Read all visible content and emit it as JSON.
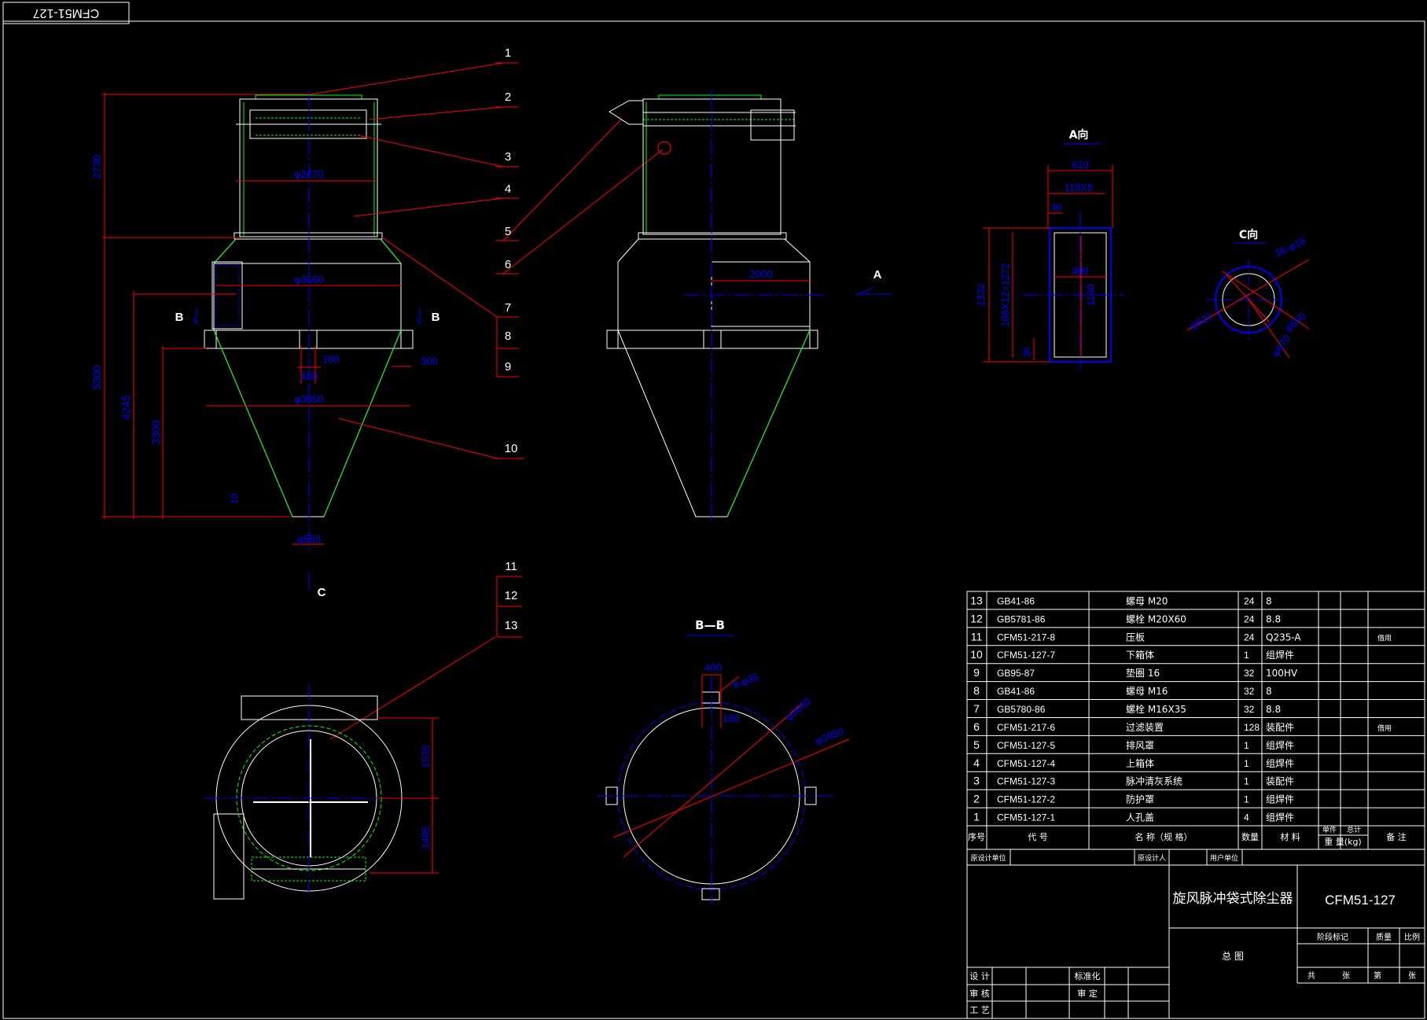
{
  "drawing_code_mirrored": "CFM51-127",
  "leaders": [
    "1",
    "2",
    "3",
    "4",
    "5",
    "6",
    "7",
    "8",
    "9",
    "10",
    "11",
    "12",
    "13"
  ],
  "front_view": {
    "dims": {
      "h2730": "2730",
      "h5300": "5300",
      "h4245": "4245",
      "h3300": "3300",
      "d2670": "φ2670",
      "d3660": "φ3660",
      "d3950": "φ3950",
      "d550": "φ550",
      "w180": "180",
      "w300": "300",
      "w480": "480",
      "s10": "10"
    },
    "section_b": "B",
    "view_c": "C"
  },
  "side_view": {
    "dim2000": "2000",
    "view_a": "A"
  },
  "view_a": {
    "title": "A向",
    "w610": "610",
    "w118": "118X5",
    "w30": "30",
    "w490": "490",
    "h1332": "1332",
    "h1272": "106X12=1272",
    "h1180": "1180",
    "h36": "36"
  },
  "view_c": {
    "title": "C向",
    "holes": "16-φ18",
    "d620": "φ620",
    "d650": "φ650",
    "d670": "φ670"
  },
  "section_bb": {
    "title": "B—B",
    "w400": "400",
    "holes": "8-φ35",
    "w180": "180",
    "d3660": "φ3660",
    "d3950": "φ3950"
  },
  "plan_view": {
    "h1535": "1535",
    "h1485": "1485"
  },
  "bom": {
    "rows": [
      {
        "no": "13",
        "code": "GB41-86",
        "name": "螺母 M20",
        "qty": "24",
        "mat": "8",
        "note": ""
      },
      {
        "no": "12",
        "code": "GB5781-86",
        "name": "螺栓 M20X60",
        "qty": "24",
        "mat": "8.8",
        "note": ""
      },
      {
        "no": "11",
        "code": "CFM51-217-8",
        "name": "压板",
        "qty": "24",
        "mat": "Q235-A",
        "note": "借用"
      },
      {
        "no": "10",
        "code": "CFM51-127-7",
        "name": "下箱体",
        "qty": "1",
        "mat": "组焊件",
        "note": ""
      },
      {
        "no": "9",
        "code": "GB95-87",
        "name": "垫圈 16",
        "qty": "32",
        "mat": "100HV",
        "note": ""
      },
      {
        "no": "8",
        "code": "GB41-86",
        "name": "螺母 M16",
        "qty": "32",
        "mat": "8",
        "note": ""
      },
      {
        "no": "7",
        "code": "GB5780-86",
        "name": "螺栓 M16X35",
        "qty": "32",
        "mat": "8.8",
        "note": ""
      },
      {
        "no": "6",
        "code": "CFM51-217-6",
        "name": "过滤装置",
        "qty": "128",
        "mat": "装配件",
        "note": "借用"
      },
      {
        "no": "5",
        "code": "CFM51-127-5",
        "name": "排风罩",
        "qty": "1",
        "mat": "组焊件",
        "note": ""
      },
      {
        "no": "4",
        "code": "CFM51-127-4",
        "name": "上箱体",
        "qty": "1",
        "mat": "组焊件",
        "note": ""
      },
      {
        "no": "3",
        "code": "CFM51-127-3",
        "name": "脉冲清灰系统",
        "qty": "1",
        "mat": "装配件",
        "note": ""
      },
      {
        "no": "2",
        "code": "CFM51-127-2",
        "name": "防护罩",
        "qty": "1",
        "mat": "组焊件",
        "note": ""
      },
      {
        "no": "1",
        "code": "CFM51-127-1",
        "name": "人孔盖",
        "qty": "4",
        "mat": "组焊件",
        "note": ""
      }
    ],
    "header": {
      "no": "序号",
      "code": "代 号",
      "name": "名 称（规 格）",
      "qty": "数量",
      "mat": "材 料",
      "unit": "单件",
      "total": "总计",
      "weight": "重 量(kg)",
      "note": "备 注"
    }
  },
  "title_block": {
    "orig_design_unit": "原设计单位",
    "orig_designer": "原设计人",
    "user_unit": "用户单位",
    "product_name": "旋风脉冲袋式除尘器",
    "drawing_code": "CFM51-127",
    "drawing_name": "总 图",
    "stage": "阶段标记",
    "weight": "质量",
    "scale": "比例",
    "sheets_total": "共",
    "sheets_label": "张",
    "sheet_no": "第",
    "sheet_label": "张",
    "design": "设 计",
    "check": "审 核",
    "process": "工 艺",
    "standard": "标准化",
    "approve": "审 定"
  }
}
